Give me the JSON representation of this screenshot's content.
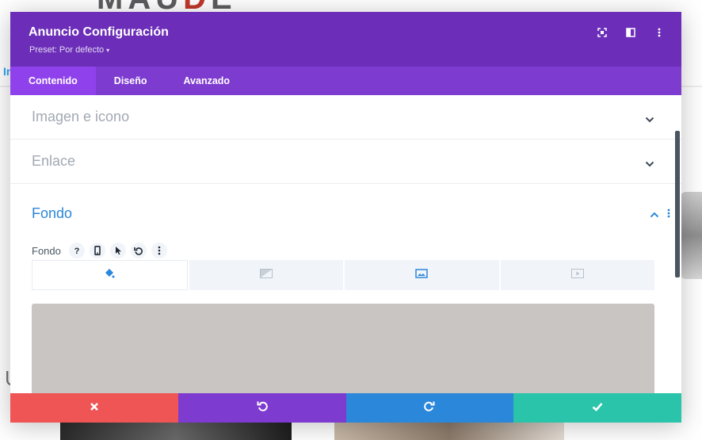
{
  "background_page": {
    "logo_text_left": "MAU",
    "logo_text_red": "D",
    "logo_text_right": "E",
    "side_text": "In",
    "side_letter": "U"
  },
  "modal": {
    "title": "Anuncio Configuración",
    "preset_label": "Preset: Por defecto",
    "header_icons": [
      "fullscreen-icon",
      "split-view-icon",
      "more-vertical-icon"
    ],
    "tabs": [
      {
        "label": "Contenido",
        "active": true
      },
      {
        "label": "Diseño",
        "active": false
      },
      {
        "label": "Avanzado",
        "active": false
      }
    ],
    "sections": [
      {
        "title": "Imagen e icono",
        "expanded": false
      },
      {
        "title": "Enlace",
        "expanded": false
      },
      {
        "title": "Fondo",
        "expanded": true
      }
    ],
    "fondo_field": {
      "label": "Fondo",
      "controls": [
        "help-icon",
        "mobile-icon",
        "hover-cursor-icon",
        "reset-icon",
        "more-vertical-icon"
      ]
    },
    "background_type_tabs": [
      {
        "icon": "paint-bucket-icon",
        "active": true
      },
      {
        "icon": "gradient-icon",
        "active": false
      },
      {
        "icon": "image-icon",
        "active": false
      },
      {
        "icon": "video-icon",
        "active": false
      }
    ],
    "preview_color": "#c9c5c3",
    "footer_buttons": [
      {
        "icon": "close-icon",
        "color": "#ef5555"
      },
      {
        "icon": "undo-icon",
        "color": "#7e3bd0"
      },
      {
        "icon": "redo-icon",
        "color": "#2b87da"
      },
      {
        "icon": "check-icon",
        "color": "#29c4a9"
      }
    ]
  },
  "colors": {
    "header": "#6c2eb9",
    "tabs_bar": "#7e3bd0",
    "active_tab": "#8f42ec",
    "accent_blue": "#2b87da"
  }
}
